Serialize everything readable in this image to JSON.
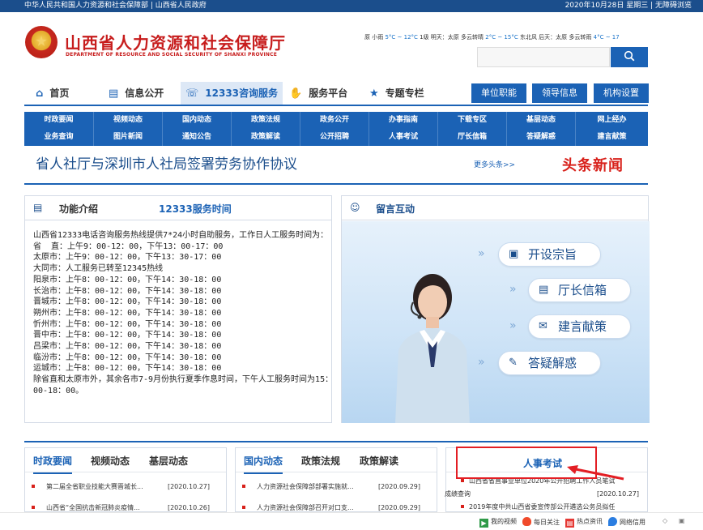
{
  "topbar": {
    "left": "中华人民共和国人力资源和社会保障部 | 山西省人民政府",
    "right": "2020年10月28日 星期三 | 无障碍浏览"
  },
  "header": {
    "title": "山西省人力资源和社会保障厅",
    "subtitle": "DEPARTMENT OF RESOURCE AND SOCIAL SECURITY OF SHANXI PROVINCE",
    "weather_prefix": "原 小雨 ",
    "weather_t1": "5°C ~ 12°C",
    "weather_mid": " 1级 明天：太原 多云转晴 ",
    "weather_t2": "2°C ~ 15°C",
    "weather_mid2": " 东北风 后天：太原 多云转雨 ",
    "weather_t3": "4°C ~ 17",
    "search_placeholder": "",
    "search_icon": "search-icon"
  },
  "mainnav": {
    "items": [
      {
        "label": "首页",
        "icon": "home-icon"
      },
      {
        "label": "信息公开",
        "icon": "document-icon"
      },
      {
        "label": "12333咨询服务",
        "icon": "phone-icon"
      },
      {
        "label": "服务平台",
        "icon": "thumbs-up-icon"
      },
      {
        "label": "专题专栏",
        "icon": "star-icon"
      }
    ],
    "buttons": [
      "单位职能",
      "领导信息",
      "机构设置"
    ]
  },
  "subnav": {
    "columns": [
      [
        "时政要闻",
        "业务查询"
      ],
      [
        "视频动态",
        "图片新闻"
      ],
      [
        "国内动态",
        "通知公告"
      ],
      [
        "政策法规",
        "政策解读"
      ],
      [
        "政务公开",
        "公开招聘"
      ],
      [
        "办事指南",
        "人事考试"
      ],
      [
        "下载专区",
        "厅长信箱"
      ],
      [
        "基层动态",
        "答疑解惑"
      ],
      [
        "网上经办",
        "建言献策"
      ]
    ]
  },
  "headline": {
    "text": "省人社厅与深圳市人社局签署劳务协作协议",
    "more": "更多头条>>",
    "label": "头条新闻"
  },
  "intro": {
    "title": "功能介绍",
    "subtitle": "12333服务时间",
    "lines": [
      "山西省12333电话咨询服务热线提供7*24小时自助服务，工作日人工服务时间为：",
      "省  直：上午9：00-12：00，下午13：00-17：00",
      "太原市：上午9：00-12：00，下午13：30-17：00",
      "大同市：人工服务已转至12345热线",
      "阳泉市：上午8：00-12：00，下午14：30-18：00",
      "长治市：上午8：00-12：00，下午14：30-18：00",
      "晋城市：上午8：00-12：00，下午14：30-18：00",
      "朔州市：上午8：00-12：00，下午14：30-18：00",
      "忻州市：上午8：00-12：00，下午14：30-18：00",
      "晋中市：上午8：00-12：00，下午14：30-18：00",
      "吕梁市：上午8：00-12：00，下午14：30-18：00",
      "临汾市：上午8：00-12：00，下午14：30-18：00",
      "运城市：上午8：00-12：00，下午14：30-18：00",
      "除省直和太原市外，其余各市7-9月份执行夏季作息时间，下午人工服务时间为15：00-18：00。"
    ]
  },
  "message": {
    "title": "留言互动",
    "buttons": [
      {
        "label": "开设宗旨",
        "icon": "book-icon"
      },
      {
        "label": "厅长信箱",
        "icon": "mailbox-icon"
      },
      {
        "label": "建言献策",
        "icon": "chat-icon"
      },
      {
        "label": "答疑解惑",
        "icon": "question-icon"
      }
    ]
  },
  "news1": {
    "tabs": [
      "时政要闻",
      "视频动态",
      "基层动态"
    ],
    "rows": [
      {
        "title": "第二届全省职业技能大赛晋城长...",
        "date": "[2020.10.27]"
      },
      {
        "title": "山西省“全国抗击新冠肺炎疫情...",
        "date": "[2020.10.26]"
      }
    ]
  },
  "news2": {
    "tabs": [
      "国内动态",
      "政策法规",
      "政策解读"
    ],
    "rows": [
      {
        "title": "人力资源社会保障部部署实施就...",
        "date": "[2020.09.29]"
      },
      {
        "title": "人力资源社会保障部召开对口支...",
        "date": "[2020.09.29]"
      }
    ]
  },
  "news3": {
    "tab": "人事考试",
    "row1a": "山西省省直事业单位2020年公开招聘工作人员笔试",
    "row1b": "成绩查询",
    "row1date": "[2020.10.27]",
    "row2": "2019年度中共山西省委宣传部公开遴选公务员拟任"
  },
  "statusbar": {
    "items": [
      {
        "label": "我的视频",
        "icon": "video-icon",
        "color": "#2f9a48"
      },
      {
        "label": "每日关注",
        "icon": "fire-icon",
        "color": "#f04a2b"
      },
      {
        "label": "热点资讯",
        "icon": "news-icon",
        "color": "#e53935"
      },
      {
        "label": "网络信用",
        "icon": "drop-icon",
        "color": "#2a7de1"
      }
    ]
  }
}
